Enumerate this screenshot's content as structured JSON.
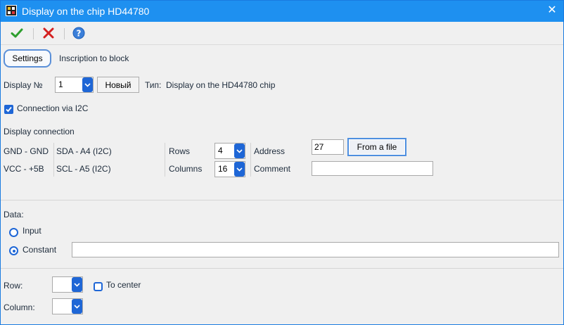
{
  "window": {
    "title": "Display on the chip HD44780",
    "close_glyph": "✕"
  },
  "toolbar": {
    "ok_icon": "checkmark-icon",
    "cancel_icon": "cross-icon",
    "help_icon": "help-icon"
  },
  "tabs": {
    "settings": "Settings",
    "inscription": "Inscription to block"
  },
  "display": {
    "label": "Display №",
    "number": "1",
    "new_button": "Новый",
    "type_label": "Тип:",
    "type_value": "Display on the HD44780 chip"
  },
  "i2c": {
    "label": "Connection via I2C",
    "checked": true
  },
  "connection": {
    "heading": "Display connection",
    "pins": [
      {
        "power": "GND - GND",
        "signal": "SDA - A4 (I2C)"
      },
      {
        "power": "VCC - +5B",
        "signal": "SCL - A5 (I2C)"
      }
    ],
    "rows_label": "Rows",
    "rows_value": "4",
    "columns_label": "Columns",
    "columns_value": "16",
    "address_label": "Address",
    "address_value": "27",
    "from_file_button": "From a file",
    "comment_label": "Comment",
    "comment_value": ""
  },
  "data": {
    "label": "Data:",
    "input_label": "Input",
    "constant_label": "Constant",
    "selected": "Constant",
    "constant_value": ""
  },
  "position": {
    "row_label": "Row:",
    "row_value": "",
    "to_center_label": "To center",
    "to_center_checked": false,
    "column_label": "Column:",
    "column_value": ""
  },
  "colors": {
    "titlebar": "#1e90f0",
    "accent": "#1e66d6",
    "ok": "#2e9e2e",
    "cancel": "#d42020"
  }
}
